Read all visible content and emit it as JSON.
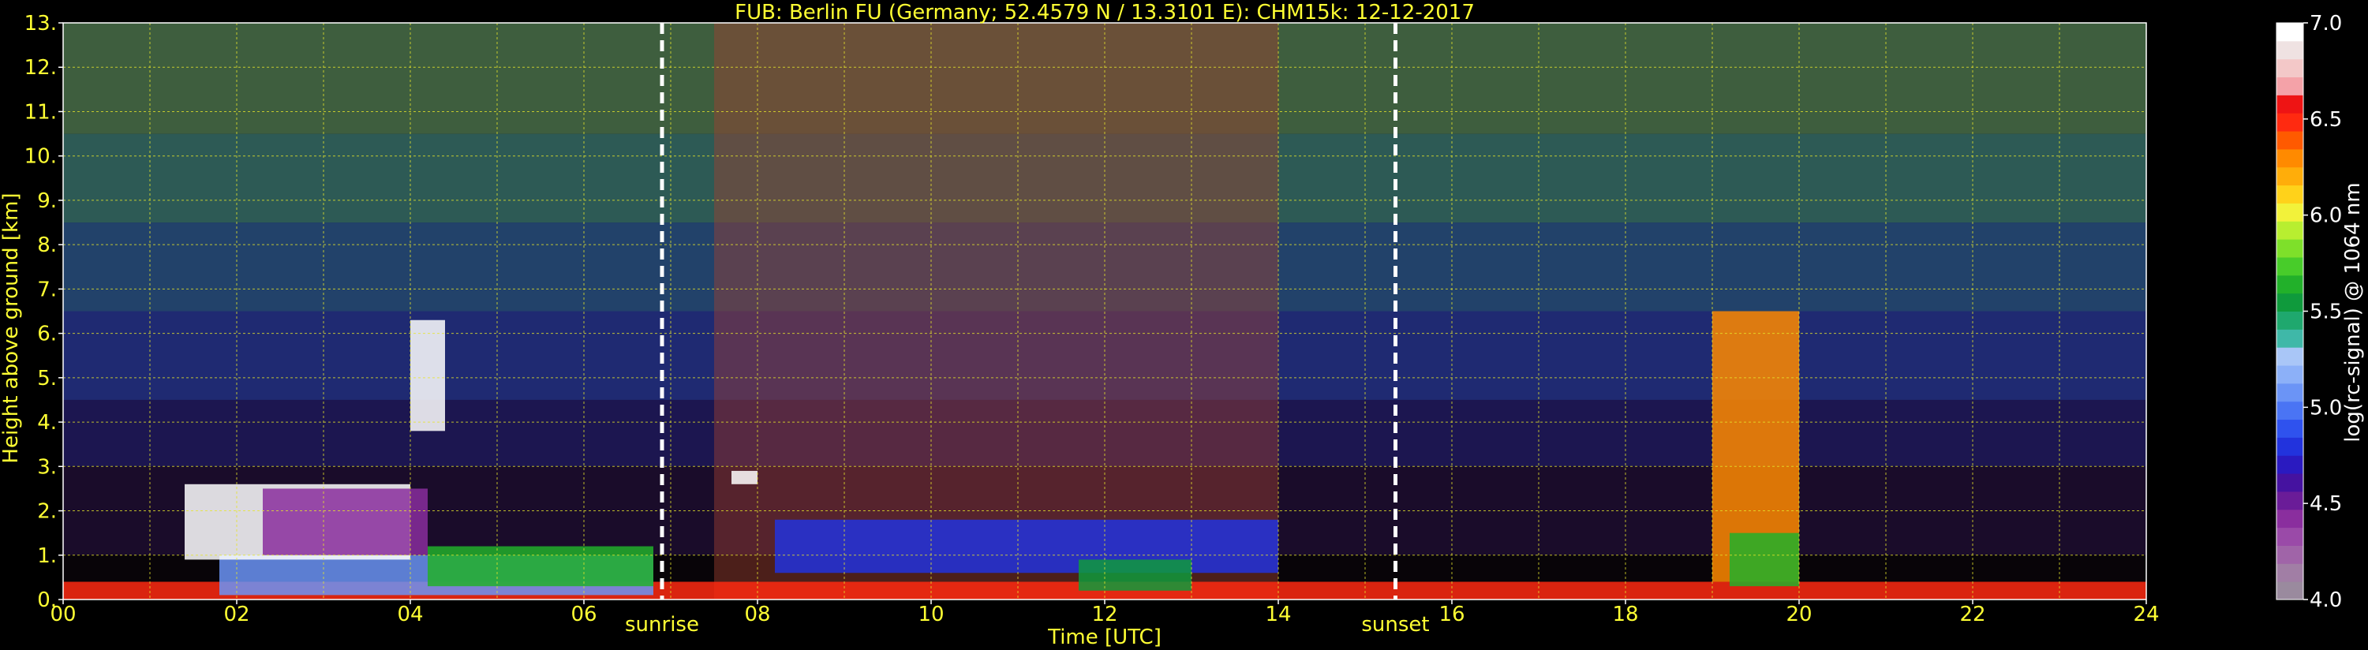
{
  "chart_data": {
    "type": "heatmap",
    "title": "FUB: Berlin FU (Germany; 52.4579 N / 13.3101 E):    CHM15k: 12-12-2017",
    "xlabel": "Time [UTC]",
    "ylabel": "Height above ground [km]",
    "xlim": [
      0,
      24
    ],
    "ylim": [
      0,
      13
    ],
    "x_ticks": [
      "00",
      "02",
      "04",
      "06",
      "08",
      "10",
      "12",
      "14",
      "16",
      "18",
      "20",
      "22",
      "24"
    ],
    "y_ticks": [
      "0.",
      "1.",
      "2.",
      "3.",
      "4.",
      "5.",
      "6.",
      "7.",
      "8.",
      "9.",
      "10.",
      "11.",
      "12.",
      "13."
    ],
    "grid": true,
    "markers": [
      {
        "label": "sunrise",
        "x": 6.9
      },
      {
        "label": "sunset",
        "x": 15.35
      }
    ],
    "colorbar": {
      "label": "log(rc-signal) @ 1064 nm",
      "min": 4.0,
      "max": 7.0,
      "ticks": [
        "4.0",
        "4.5",
        "5.0",
        "5.5",
        "6.0",
        "6.5",
        "7.0"
      ],
      "colors": [
        "#9a8a9e",
        "#a17ea5",
        "#a064a8",
        "#9a4aa8",
        "#8a2e9e",
        "#6a1c98",
        "#4512a0",
        "#2a1ac0",
        "#2233dd",
        "#2f52ee",
        "#4a74f4",
        "#6b94f6",
        "#8cb0f8",
        "#a9c6f7",
        "#3fb8a8",
        "#1fa86e",
        "#0f9a3c",
        "#22b02a",
        "#48cc2a",
        "#7ee02a",
        "#b8ee30",
        "#f2f23a",
        "#ffd21a",
        "#ffad0a",
        "#ff8a00",
        "#ff5a00",
        "#ff2a10",
        "#ee1414",
        "#f4a2a8",
        "#f3c8c8",
        "#efe2e2",
        "#ffffff"
      ]
    },
    "background_bands": [
      {
        "y_from": 0.0,
        "y_to": 1.0,
        "color": "#080408"
      },
      {
        "y_from": 1.0,
        "y_to": 3.0,
        "color": "#1a0c2a"
      },
      {
        "y_from": 3.0,
        "y_to": 4.5,
        "color": "#1c1650"
      },
      {
        "y_from": 4.5,
        "y_to": 6.5,
        "color": "#1f2a72"
      },
      {
        "y_from": 6.5,
        "y_to": 8.5,
        "color": "#22426a"
      },
      {
        "y_from": 8.5,
        "y_to": 10.5,
        "color": "#2d5a55"
      },
      {
        "y_from": 10.5,
        "y_to": 13.0,
        "color": "#3e5e3e"
      }
    ],
    "noise_region": {
      "x_from": 7.5,
      "x_to": 14.0,
      "color": "#a04030"
    },
    "features": [
      {
        "name": "surface-aerosol",
        "x_from": 0.0,
        "x_to": 24.0,
        "y_from": 0.0,
        "y_to": 0.4,
        "color": "#ff2a10"
      },
      {
        "name": "boundary-layer-blue",
        "x_from": 1.8,
        "x_to": 6.8,
        "y_from": 0.1,
        "y_to": 1.0,
        "color": "#6b94f6"
      },
      {
        "name": "cloud-morning",
        "x_from": 1.4,
        "x_to": 4.0,
        "y_from": 0.9,
        "y_to": 2.6,
        "color": "#ffffff"
      },
      {
        "name": "purple-layer",
        "x_from": 2.3,
        "x_to": 4.2,
        "y_from": 1.0,
        "y_to": 2.5,
        "color": "#8a2e9e"
      },
      {
        "name": "cloud-0430",
        "x_from": 4.0,
        "x_to": 4.4,
        "y_from": 3.8,
        "y_to": 6.3,
        "color": "#ffffff"
      },
      {
        "name": "green-layer",
        "x_from": 4.2,
        "x_to": 6.8,
        "y_from": 0.3,
        "y_to": 1.2,
        "color": "#22b02a"
      },
      {
        "name": "cloud-0730",
        "x_from": 7.7,
        "x_to": 8.0,
        "y_from": 2.6,
        "y_to": 2.9,
        "color": "#ffffff"
      },
      {
        "name": "blue-layer-midday",
        "x_from": 8.2,
        "x_to": 14.0,
        "y_from": 0.6,
        "y_to": 1.8,
        "color": "#2233dd"
      },
      {
        "name": "green-midday",
        "x_from": 11.7,
        "x_to": 13.0,
        "y_from": 0.2,
        "y_to": 0.9,
        "color": "#0f9a3c"
      },
      {
        "name": "cloud-evening",
        "x_from": 19.0,
        "x_to": 20.0,
        "y_from": 0.4,
        "y_to": 6.5,
        "color": "#ff8a00"
      },
      {
        "name": "green-evening",
        "x_from": 19.2,
        "x_to": 20.0,
        "y_from": 0.3,
        "y_to": 1.5,
        "color": "#22b02a"
      }
    ]
  }
}
